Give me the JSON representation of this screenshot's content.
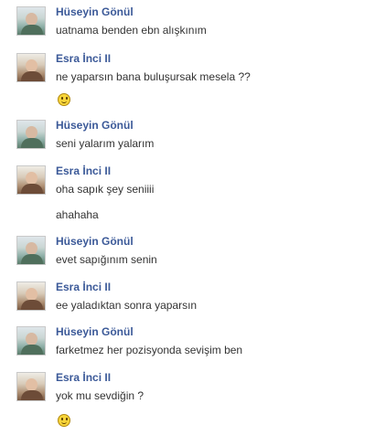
{
  "messages": [
    {
      "sender": "Hüseyin Gönül",
      "lines": [
        "uatnama benden ebn alışkınım"
      ],
      "smiley": false
    },
    {
      "sender": "Esra İnci II",
      "lines": [
        "ne yaparsın bana buluşursak mesela ??"
      ],
      "smiley": true
    },
    {
      "sender": "Hüseyin Gönül",
      "lines": [
        "seni yalarım yalarım"
      ],
      "smiley": false
    },
    {
      "sender": "Esra İnci II",
      "lines": [
        "oha sapık şey seniiii",
        "ahahaha"
      ],
      "smiley": false
    },
    {
      "sender": "Hüseyin Gönül",
      "lines": [
        "evet sapığınım senin"
      ],
      "smiley": false
    },
    {
      "sender": "Esra İnci II",
      "lines": [
        "ee yaladıktan sonra yaparsın"
      ],
      "smiley": false
    },
    {
      "sender": "Hüseyin Gönül",
      "lines": [
        "farketmez her pozisyonda sevişim ben"
      ],
      "smiley": false
    },
    {
      "sender": "Esra İnci II",
      "lines": [
        "yok mu sevdiğin ?"
      ],
      "smiley": true
    }
  ],
  "icons": {
    "avatar": "profile-photo",
    "emoticon": "smiley-icon"
  },
  "colors": {
    "name": "#3b5998",
    "text": "#333333"
  }
}
